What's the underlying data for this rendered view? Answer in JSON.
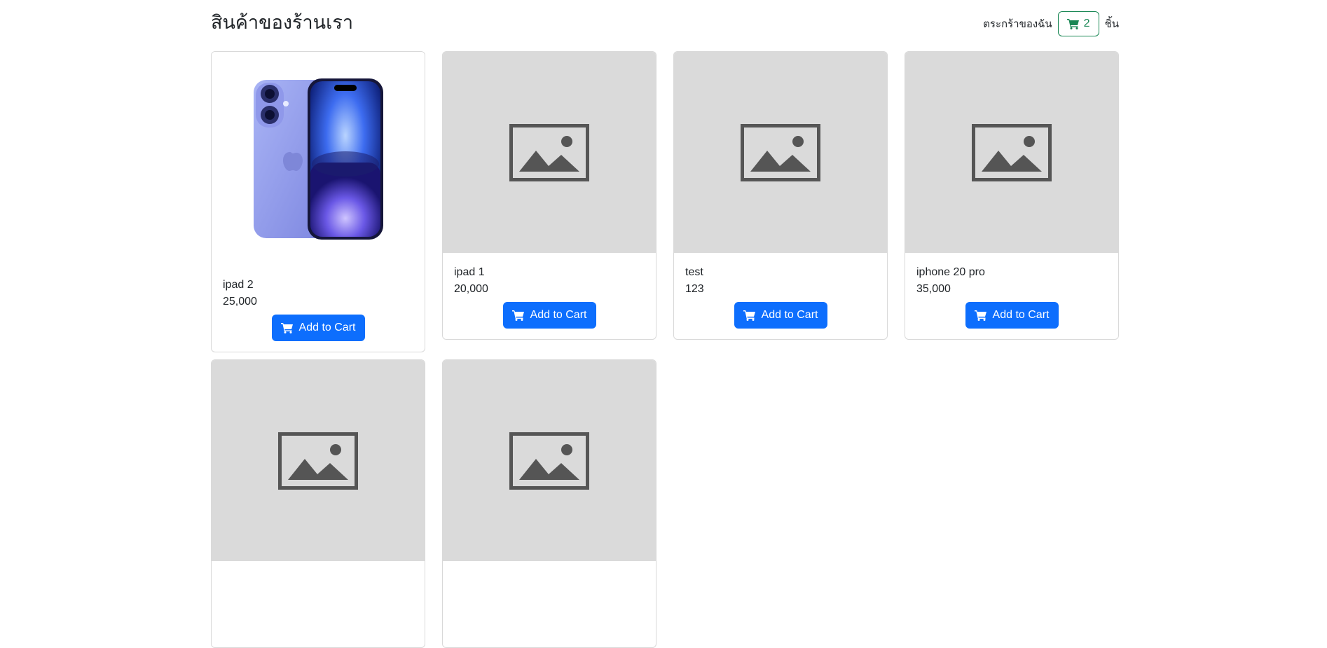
{
  "header": {
    "title": "สินค้าของร้านเรา",
    "cart_label": "ตระกร้าของฉัน",
    "cart_count": "2",
    "cart_unit": "ชิ้น"
  },
  "products": [
    {
      "name": "ipad 2",
      "price": "25,000",
      "button_label": "Add to Cart",
      "image": "iphone-photo"
    },
    {
      "name": "ipad 1",
      "price": "20,000",
      "button_label": "Add to Cart",
      "image": "image-placeholder-icon"
    },
    {
      "name": "test",
      "price": "123",
      "button_label": "Add to Cart",
      "image": "image-placeholder-icon"
    },
    {
      "name": "iphone 20 pro",
      "price": "35,000",
      "button_label": "Add to Cart",
      "image": "image-placeholder-icon"
    },
    {
      "name": "",
      "price": "",
      "button_label": "",
      "image": "image-placeholder-icon"
    },
    {
      "name": "",
      "price": "",
      "button_label": "",
      "image": "image-placeholder-icon"
    }
  ],
  "colors": {
    "primary": "#0d6efd",
    "success": "#198754",
    "placeholder_bg": "#dadada",
    "placeholder_icon": "#555555"
  }
}
